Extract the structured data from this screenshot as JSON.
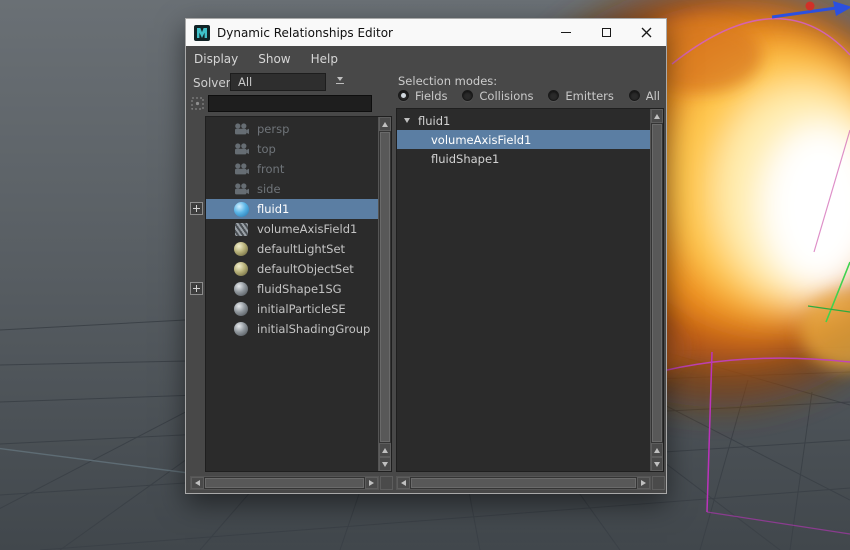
{
  "window": {
    "title": "Dynamic Relationships Editor"
  },
  "menu": {
    "items": [
      {
        "label": "Display"
      },
      {
        "label": "Show"
      },
      {
        "label": "Help"
      }
    ]
  },
  "solver": {
    "label": "Solver",
    "value": "All"
  },
  "filter_field": {
    "value": "",
    "placeholder": ""
  },
  "outliner": {
    "items": [
      {
        "label": "persp",
        "type": "camera",
        "muted": true
      },
      {
        "label": "top",
        "type": "camera",
        "muted": true
      },
      {
        "label": "front",
        "type": "camera",
        "muted": true
      },
      {
        "label": "side",
        "type": "camera",
        "muted": true
      },
      {
        "label": "fluid1",
        "type": "fluid",
        "selected": true,
        "expandable": true
      },
      {
        "label": "volumeAxisField1",
        "type": "field"
      },
      {
        "label": "defaultLightSet",
        "type": "set"
      },
      {
        "label": "defaultObjectSet",
        "type": "set"
      },
      {
        "label": "fluidShape1SG",
        "type": "sg",
        "expandable": true
      },
      {
        "label": "initialParticleSE",
        "type": "sg"
      },
      {
        "label": "initialShadingGroup",
        "type": "sg"
      }
    ]
  },
  "selection_modes": {
    "label": "Selection modes:",
    "options": [
      {
        "label": "Fields",
        "selected": true
      },
      {
        "label": "Collisions",
        "selected": false
      },
      {
        "label": "Emitters",
        "selected": false
      },
      {
        "label": "All",
        "selected": false
      }
    ]
  },
  "tree": {
    "root": {
      "label": "fluid1",
      "expanded": true
    },
    "children": [
      {
        "label": "volumeAxisField1",
        "selected": true
      },
      {
        "label": "fluidShape1",
        "selected": false
      }
    ]
  },
  "colors": {
    "selection_highlight": "#5b7ea3",
    "window_bg": "#484848",
    "panel_bg": "#2b2b2b",
    "titlebar_bg": "#f9f9f9",
    "text": "#c8c8c8",
    "muted_text": "#6f7479",
    "explosion_core": "#ffffff",
    "explosion_mid": "#f29b2a",
    "explosion_outer": "#7e4016"
  }
}
